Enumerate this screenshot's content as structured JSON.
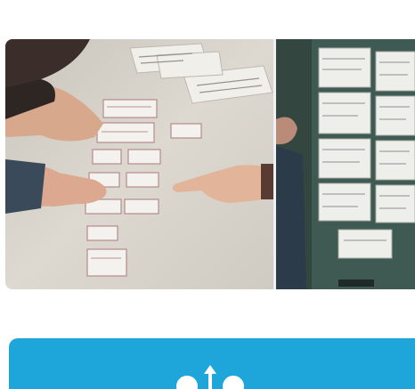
{
  "gallery": {
    "images": [
      {
        "name": "workshop-table-photo",
        "description": ""
      },
      {
        "name": "wall-sketches-photo",
        "description": ""
      }
    ]
  },
  "banner": {
    "color": "#1ea6db",
    "icon": "people-share-icon"
  }
}
